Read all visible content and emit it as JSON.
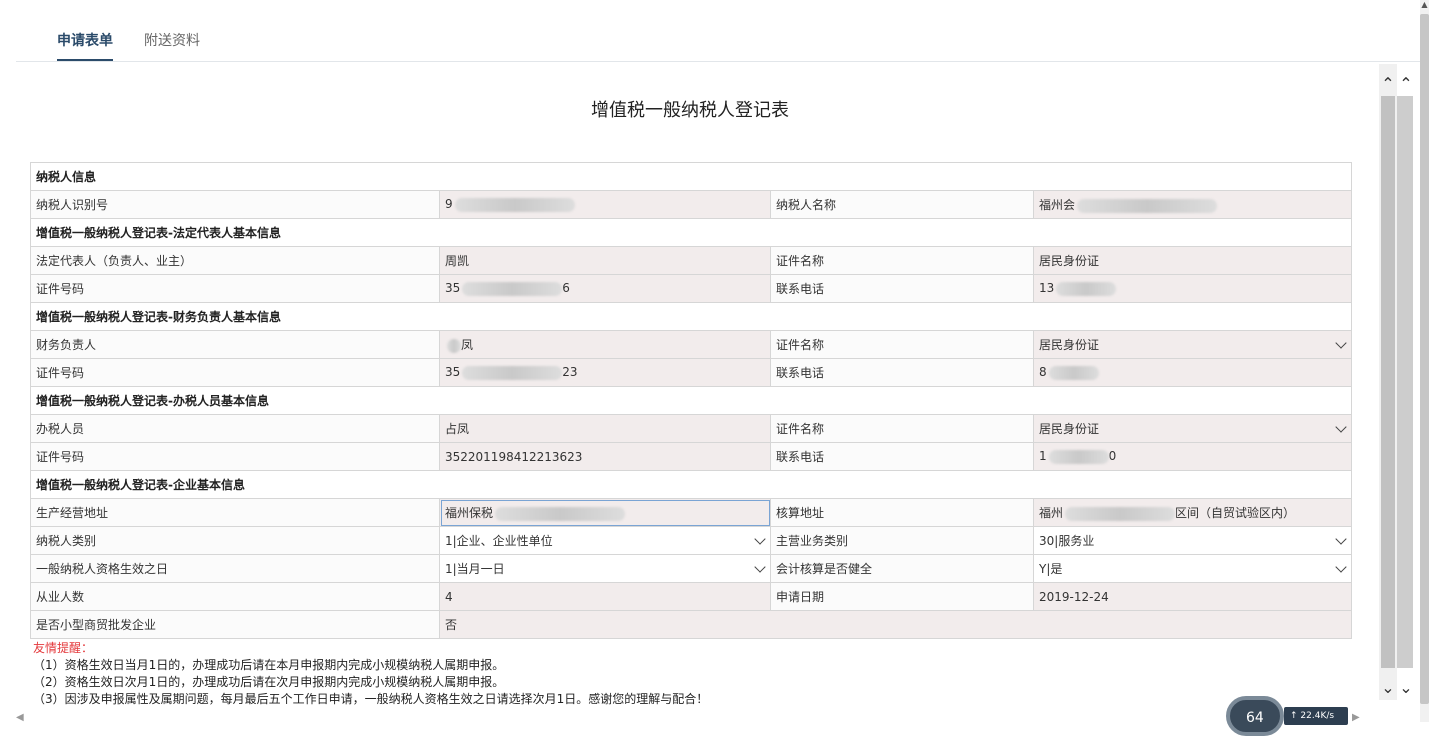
{
  "tabs": [
    "申请表单",
    "附送资料"
  ],
  "form_title": "增值税一般纳税人登记表",
  "sections": {
    "taxpayer_info": "纳税人信息",
    "legal_rep": "增值税一般纳税人登记表-法定代表人基本信息",
    "finance": "增值税一般纳税人登记表-财务负责人基本信息",
    "tax_officer": "增值税一般纳税人登记表-办税人员基本信息",
    "enterprise": "增值税一般纳税人登记表-企业基本信息"
  },
  "rows": {
    "taxpayer_id_label": "纳税人识别号",
    "taxpayer_id_value": "9",
    "taxpayer_name_label": "纳税人名称",
    "taxpayer_name_value": "福州会",
    "legal_rep_label": "法定代表人（负责人、业主）",
    "legal_rep_value": "周凯",
    "legal_id_type_label": "证件名称",
    "legal_id_type_value": "居民身份证",
    "legal_id_no_label": "证件号码",
    "legal_id_no_value": "35",
    "legal_id_no_suffix": "6",
    "legal_phone_label": "联系电话",
    "legal_phone_value": "13",
    "finance_label": "财务负责人",
    "finance_value": "凤",
    "finance_id_type_label": "证件名称",
    "finance_id_type_value": "居民身份证",
    "finance_id_no_label": "证件号码",
    "finance_id_no_value": "35",
    "finance_id_no_suffix": "23",
    "finance_phone_label": "联系电话",
    "finance_phone_value": "8",
    "officer_label": "办税人员",
    "officer_value": "占凤",
    "officer_id_type_label": "证件名称",
    "officer_id_type_value": "居民身份证",
    "officer_id_no_label": "证件号码",
    "officer_id_no_value": "352201198412213623",
    "officer_phone_label": "联系电话",
    "officer_phone_value": "1",
    "officer_phone_suffix": "0",
    "address_label": "生产经营地址",
    "address_value": "福州保税",
    "accounting_address_label": "核算地址",
    "accounting_address_value": "福州",
    "accounting_address_suffix": "区间（自贸试验区内）",
    "taxpayer_type_label": "纳税人类别",
    "taxpayer_type_value": "1|企业、企业性单位",
    "main_business_label": "主营业务类别",
    "main_business_value": "30|服务业",
    "effective_date_label": "一般纳税人资格生效之日",
    "effective_date_value": "1|当月一日",
    "accounting_sound_label": "会计核算是否健全",
    "accounting_sound_value": "Y|是",
    "employees_label": "从业人数",
    "employees_value": "4",
    "apply_date_label": "申请日期",
    "apply_date_value": "2019-12-24",
    "small_trade_label": "是否小型商贸批发企业",
    "small_trade_value": "否"
  },
  "tips": {
    "title": "友情提醒：",
    "lines": [
      "（1）资格生效日当月1日的，办理成功后请在本月申报期内完成小规模纳税人属期申报。",
      "（2）资格生效日次月1日的，办理成功后请在次月申报期内完成小规模纳税人属期申报。",
      "（3）因涉及申报属性及属期问题，每月最后五个工作日申请，一般纳税人资格生效之日请选择次月1日。感谢您的理解与配合！"
    ]
  },
  "net_widget": {
    "speed": "22.4",
    "unit": "K/s",
    "arrow": "↑",
    "value": "64"
  }
}
